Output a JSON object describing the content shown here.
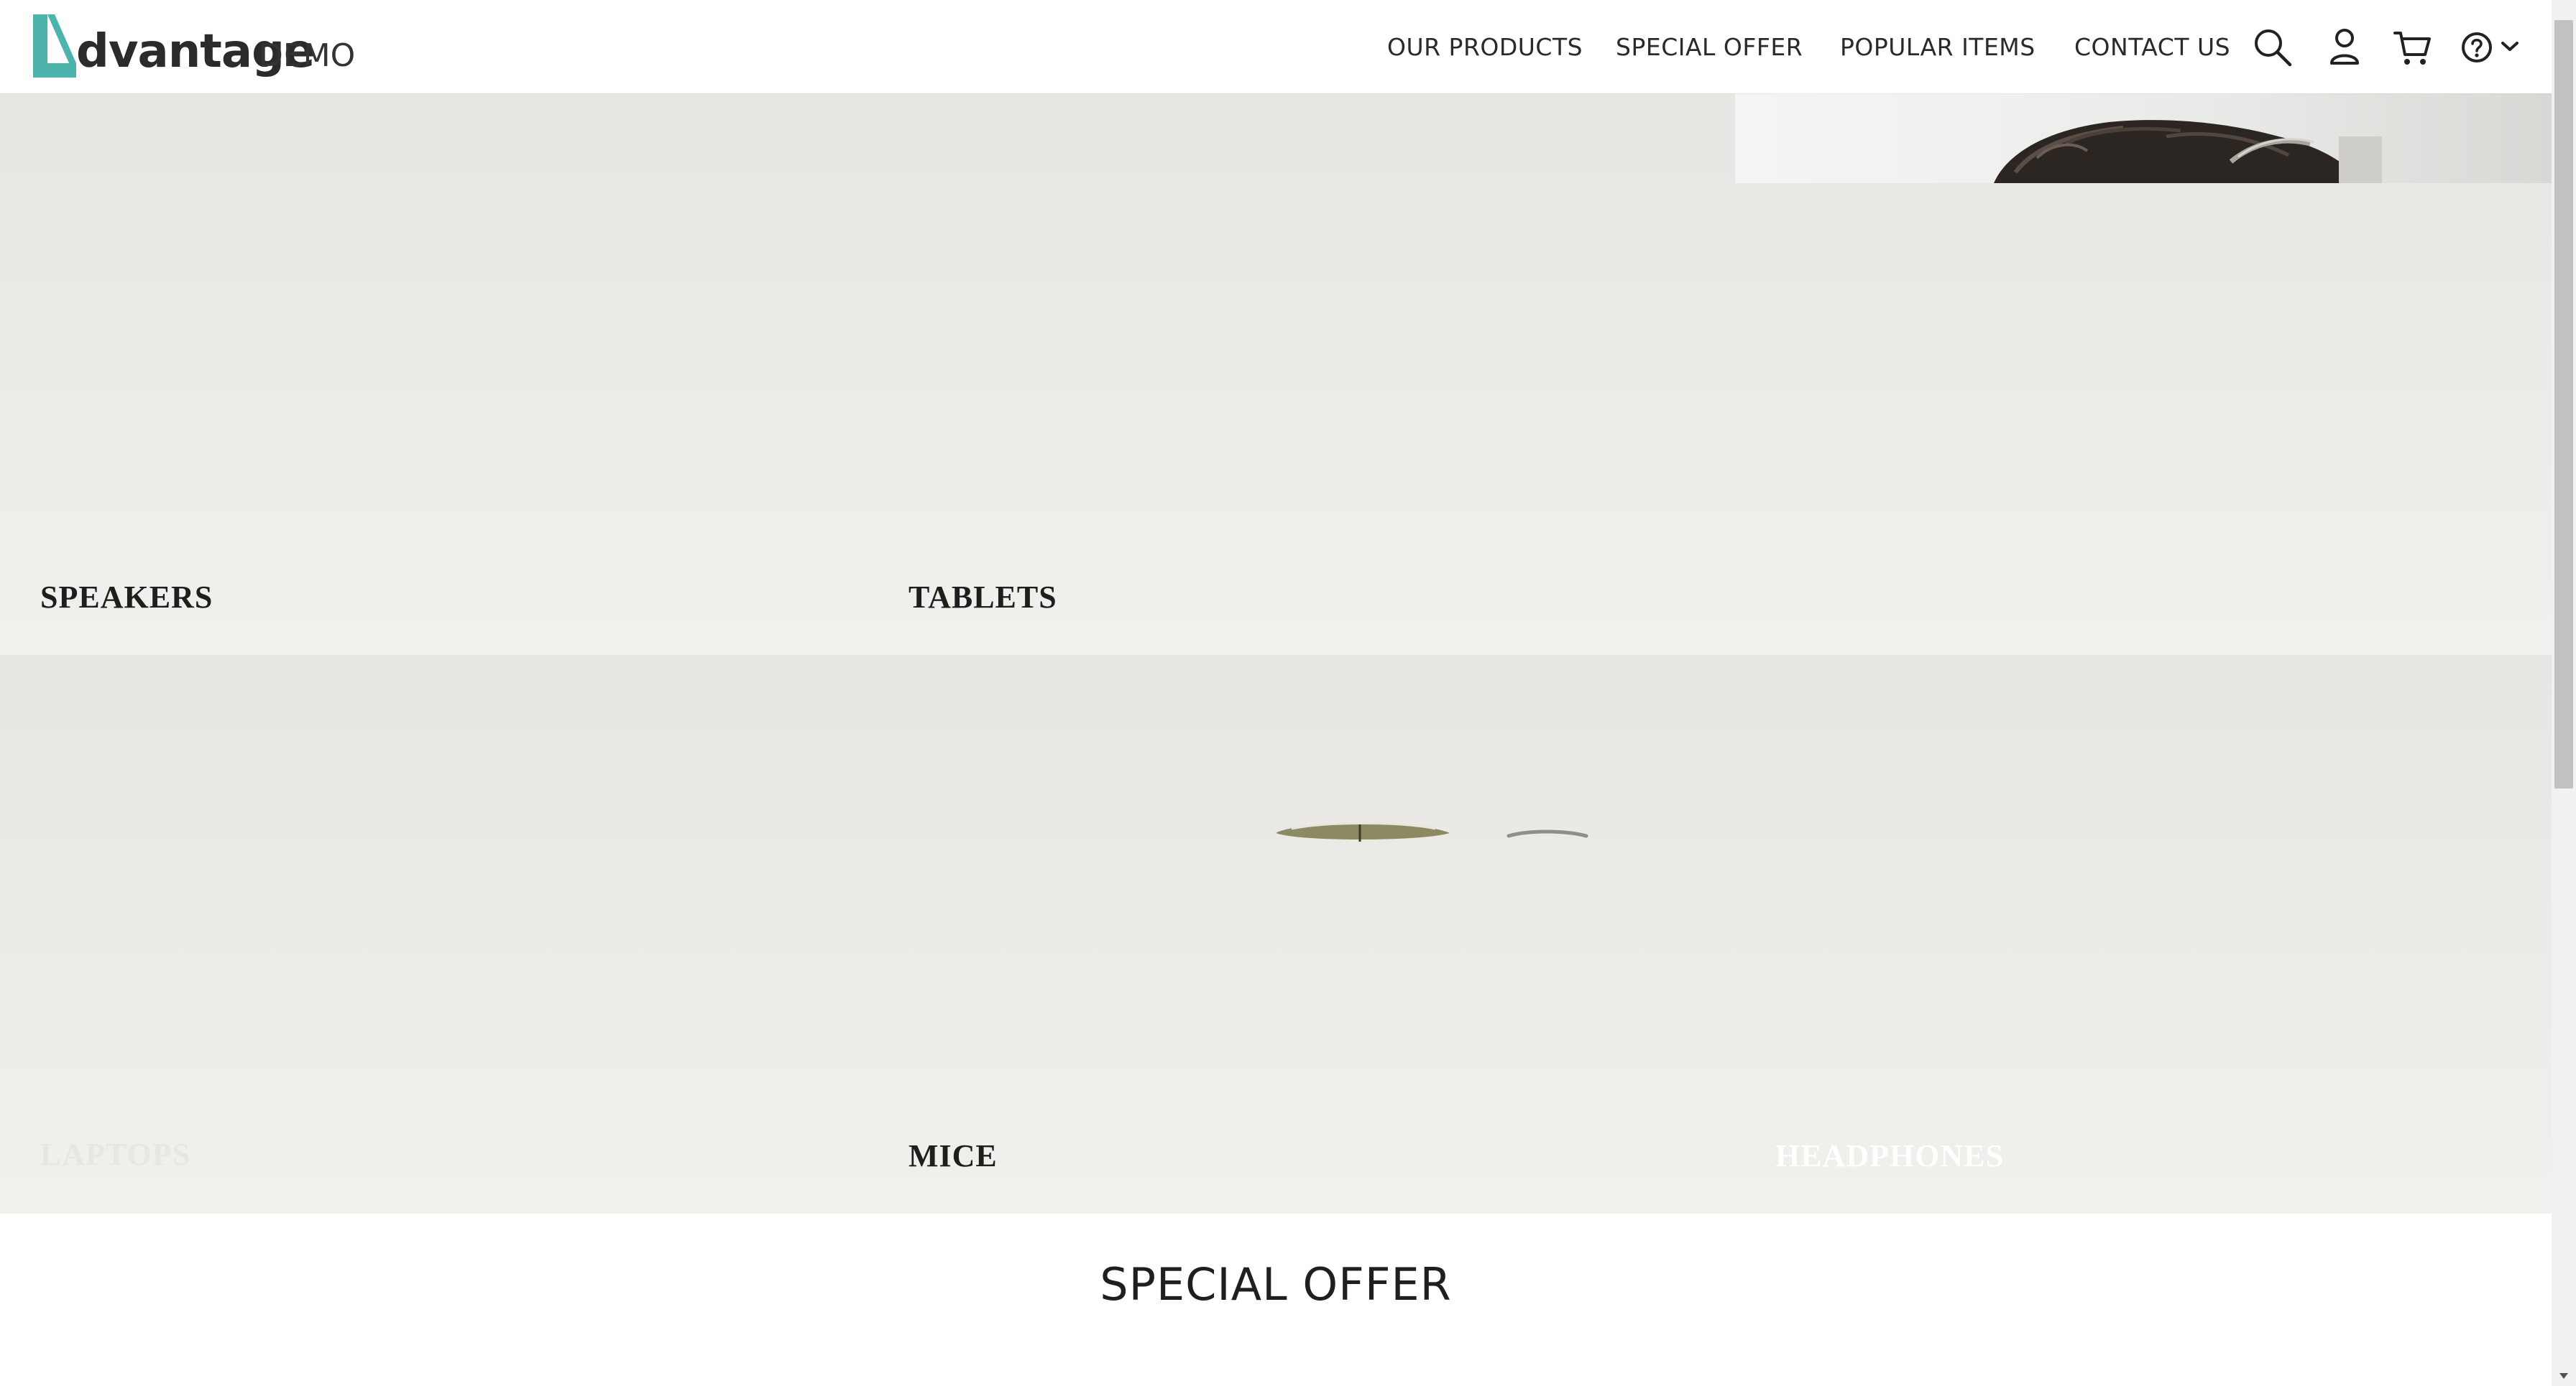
{
  "header": {
    "logo": {
      "brand": "dvantage",
      "suffix": "DEMO",
      "accent_color": "#4fb3ad"
    },
    "nav": [
      {
        "label": "OUR PRODUCTS"
      },
      {
        "label": "SPECIAL OFFER"
      },
      {
        "label": "POPULAR ITEMS"
      },
      {
        "label": "CONTACT US"
      }
    ],
    "icons": [
      "search-icon",
      "user-icon",
      "cart-icon",
      "help-icon",
      "chevron-down-icon"
    ]
  },
  "categories": [
    {
      "label": "SPEAKERS"
    },
    {
      "label": "TABLETS"
    },
    {
      "label": "LAPTOPS"
    },
    {
      "label": "MICE"
    },
    {
      "label": "HEADPHONES"
    }
  ],
  "special_offer": {
    "title": "SPECIAL OFFER"
  },
  "colors": {
    "accent": "#4fb3ad",
    "tile_background": "#ebeae6",
    "text": "#222222"
  }
}
